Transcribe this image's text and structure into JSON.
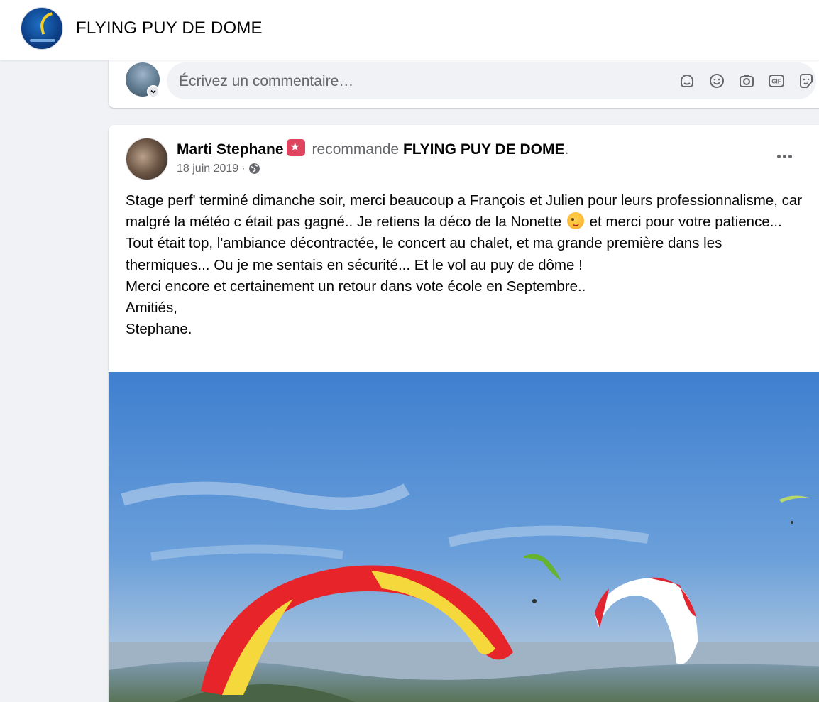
{
  "header": {
    "page_name": "FLYING PUY DE DOME"
  },
  "comment_composer": {
    "placeholder": "Écrivez un commentaire…",
    "icons": [
      "sticker-icon",
      "emoji-icon",
      "camera-icon",
      "gif-icon",
      "avatar-sticker-icon"
    ]
  },
  "post": {
    "author": "Marti Stephane",
    "recommends_text": "recommande",
    "recommended_page": "FLYING PUY DE DOME",
    "period": ".",
    "date": "18 juin 2019",
    "separator": "·",
    "paragraphs": {
      "line1": "Stage perf' terminé dimanche soir, merci beaucoup a François et Julien pour leurs professionnalisme, car malgré la météo c était pas gagné.. Je retiens la déco de la Nonette",
      "line1_end": " et merci pour votre patience...",
      "line2": "Tout était top, l'ambiance décontractée, le concert au chalet, et ma grande première dans les thermiques... Ou je me sentais en sécurité... Et le vol au puy de dôme !",
      "line3": "Merci encore et certainement un retour dans vote école en Septembre..",
      "line4": "Amitiés,",
      "line5": "Stephane."
    },
    "photo": {
      "sky_color": "#4a86d0",
      "horizon_color": "#b9c8d6",
      "wing_colors": [
        "#e6262a",
        "#f4d53a",
        "#ffffff",
        "#7cc63a"
      ]
    }
  }
}
